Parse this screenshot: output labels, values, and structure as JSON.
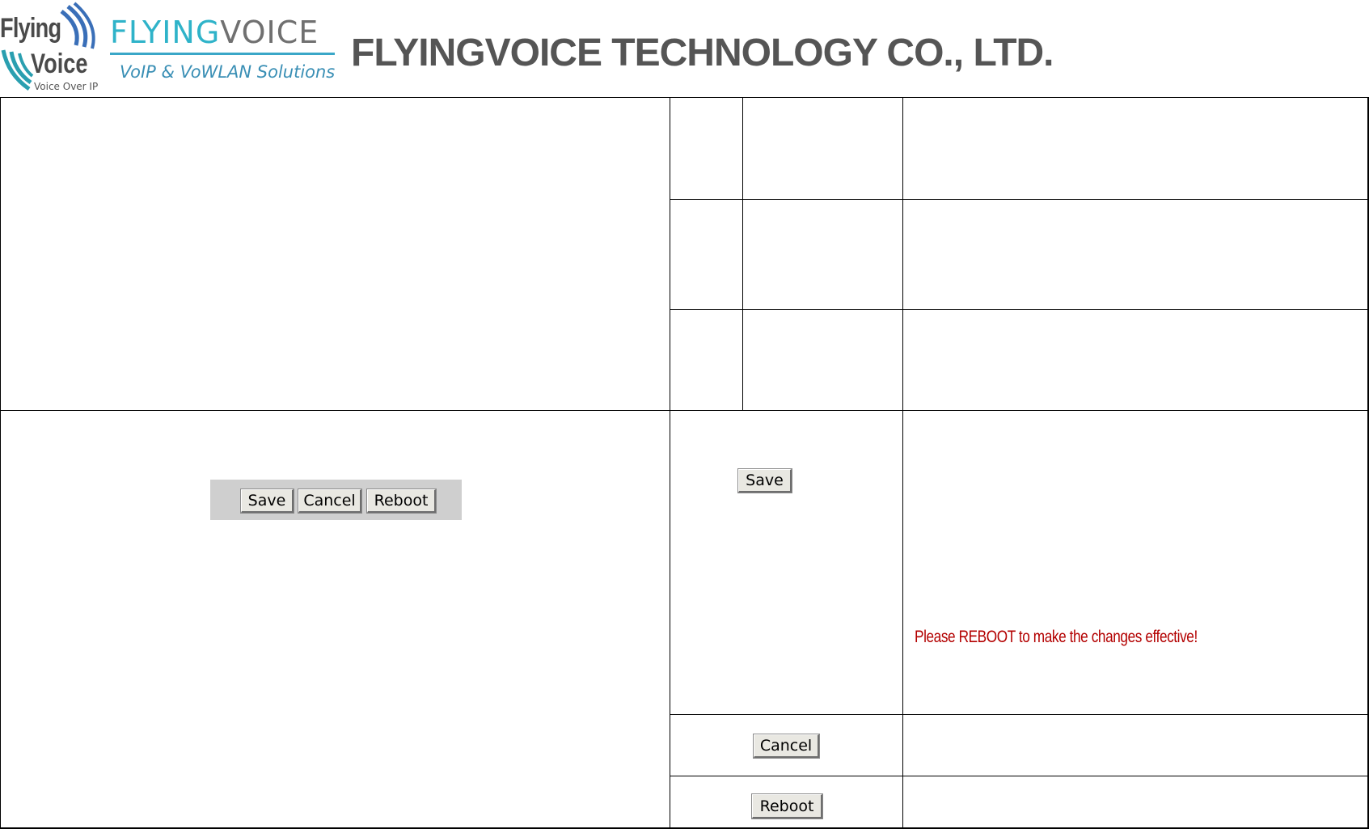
{
  "header": {
    "logo": {
      "word1": "Flying",
      "word2": "Voice",
      "subtitle": "Voice Over IP"
    },
    "brand": {
      "name_part1": "FLYING",
      "name_part2": "VOICE",
      "tagline": "VoIP & VoWLAN Solutions"
    },
    "company": "FLYINGVOICE TECHNOLOGY CO., LTD."
  },
  "button_bar": {
    "save": "Save",
    "cancel": "Cancel",
    "reboot": "Reboot"
  },
  "rows": {
    "save": {
      "button": "Save",
      "note": "Please REBOOT to make the changes effective!"
    },
    "cancel": {
      "button": "Cancel"
    },
    "reboot": {
      "button": "Reboot"
    }
  },
  "colors": {
    "brand_cyan": "#2fb3c9",
    "brand_grey": "#707070",
    "company_text": "#555555",
    "note_red": "#b30000",
    "button_face": "#e9e8e2"
  }
}
